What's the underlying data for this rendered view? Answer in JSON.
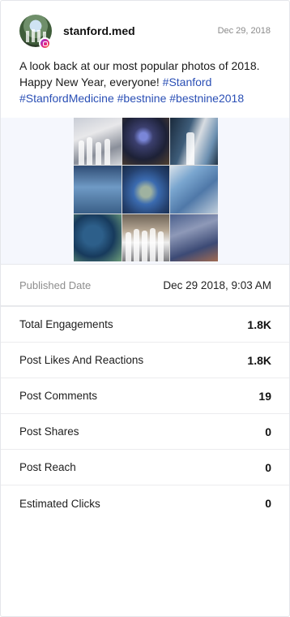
{
  "post": {
    "username": "stanford.med",
    "date": "Dec 29, 2018",
    "caption_text": "A look back at our most popular photos of 2018. Happy New Year, everyone! ",
    "hashtags": [
      "#Stanford",
      "#StanfordMedicine",
      "#bestnine",
      "#bestnine2018"
    ],
    "platform_icon": "instagram-icon",
    "avatar_icon": "stanford-med-avatar",
    "media": "best-nine-collage-2018"
  },
  "colors": {
    "hashtag": "#2a4fb5",
    "instagram_gradient": [
      "#8e36d8",
      "#e9247f",
      "#f68b2c"
    ],
    "media_background": "#f5f7fd"
  },
  "published": {
    "label": "Published Date",
    "value": "Dec 29 2018, 9:03 AM"
  },
  "metrics": [
    {
      "label": "Total Engagements",
      "value": "1.8K"
    },
    {
      "label": "Post Likes And Reactions",
      "value": "1.8K"
    },
    {
      "label": "Post Comments",
      "value": "19"
    },
    {
      "label": "Post Shares",
      "value": "0"
    },
    {
      "label": "Post Reach",
      "value": "0"
    },
    {
      "label": "Estimated Clicks",
      "value": "0"
    }
  ]
}
